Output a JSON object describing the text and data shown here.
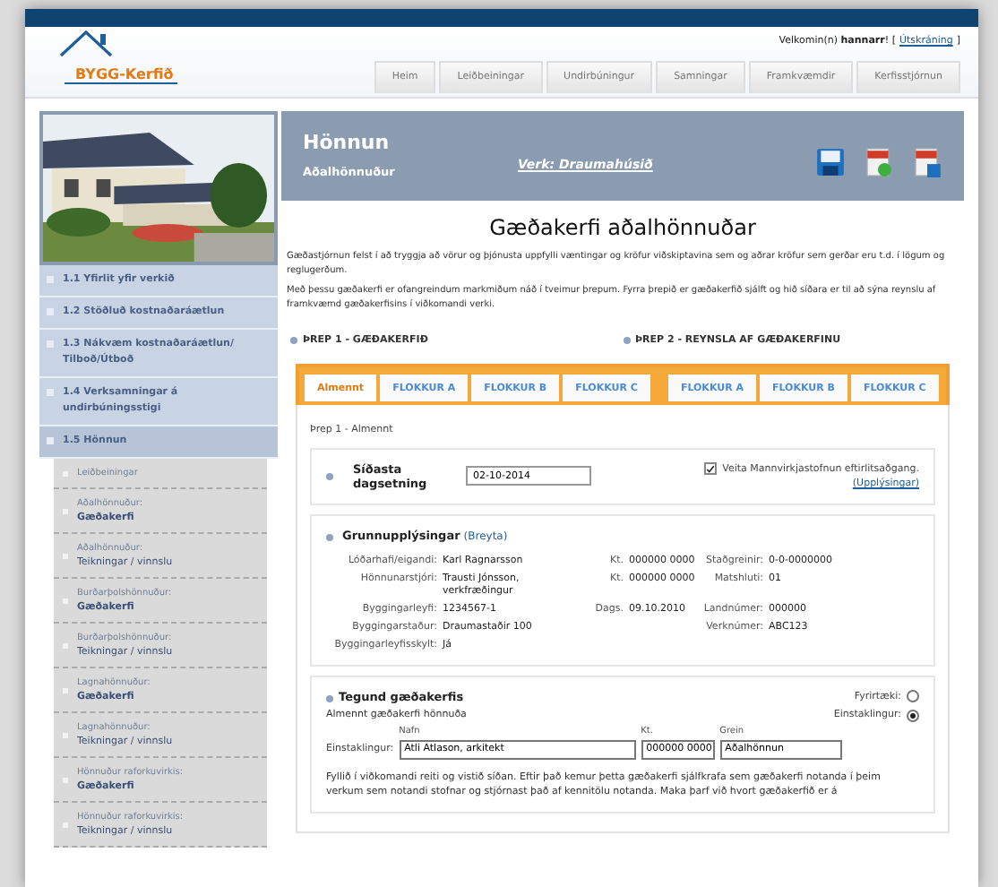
{
  "header": {
    "logo": "BYGG-Kerfið",
    "welcome": "Velkomin(n) **hannarr**! [",
    "logout": "Útskráning",
    "welcome_end": "]"
  },
  "nav": [
    {
      "label": "Heim",
      "selected": false
    },
    {
      "label": "Leiðbeiningar",
      "selected": false
    },
    {
      "label": "Undirbúningur",
      "selected": false
    },
    {
      "label": "Samningar",
      "selected": false
    },
    {
      "label": "Framkvæmdir",
      "selected": false
    },
    {
      "label": "Kerfisstjórnun",
      "selected": false
    }
  ],
  "sidebar": {
    "items": [
      {
        "label": "1.1 Yfirlit yfir verkið",
        "expanded": false
      },
      {
        "label": "1.2 Stöðluð kostnaðaráætlun",
        "expanded": false
      },
      {
        "label": "1.3 Nákvæm kostnaðaráætlun/ Tilboð/Útboð",
        "expanded": false
      },
      {
        "label": "1.4 Verksamningar á undirbúningsstigi",
        "expanded": false
      },
      {
        "label": "1.5 Hönnun",
        "expanded": true,
        "children": [
          {
            "label": "Leiðbeiningar"
          },
          {
            "label": "Aðalhönnuður:",
            "sublabel": "Gæðakerfi",
            "bold": true
          },
          {
            "label": "Aðalhönnuður:",
            "sublabel": "Teikningar / vinnslu",
            "bold": false
          },
          {
            "label": "Burðarþolshönnuður:",
            "sublabel": "Gæðakerfi",
            "bold": true
          },
          {
            "label": "Burðarþolshönnuður:",
            "sublabel": "Teikningar / vinnslu",
            "bold": false
          },
          {
            "label": "Lagnahönnuður:",
            "sublabel": "Gæðakerfi",
            "bold": true
          },
          {
            "label": "Lagnahönnuður:",
            "sublabel": "Teikningar / vinnslu",
            "bold": false
          },
          {
            "label": "Hönnuður raforkuvirkis:",
            "sublabel": "Gæðakerfi",
            "bold": true
          },
          {
            "label": "Hönnuður raforkuvirkis:",
            "sublabel": "Teikningar / vinnslu",
            "bold": false
          }
        ]
      }
    ]
  },
  "banner": {
    "title": "Hönnun",
    "subtitle": "Aðalhönnuður",
    "project": "Verk: Draumahúsið"
  },
  "heading": "Gæðakerfi aðalhönnuðar",
  "intro": [
    "Gæðastjórnun felst í að tryggja að vörur og þjónusta uppfylli væntingar og kröfur viðskiptavina sem og aðrar kröfur sem gerðar eru t.d. í lögum og reglugerðum.",
    "Með þessu gæðakerfi er ofangreindum markmiðum náð í tveimur þrepum. Fyrra þrepið er gæðakerfið sjálft og hið síðara er til að sýna reynslu af framkvæmd gæðakerfisins í viðkomandi verki."
  ],
  "steps": [
    "ÞREP 1 - GÆÐAKERFIÐ",
    "ÞREP 2 - REYNSLA AF GÆÐAKERFINU"
  ],
  "tab_groups": [
    [
      {
        "label": "Almennt",
        "selected": true
      },
      {
        "label": "FLOKKUR A",
        "selected": false
      },
      {
        "label": "FLOKKUR B",
        "selected": false
      },
      {
        "label": "FLOKKUR C",
        "selected": false
      }
    ],
    [
      {
        "label": "FLOKKUR A",
        "selected": false
      },
      {
        "label": "FLOKKUR B",
        "selected": false
      },
      {
        "label": "FLOKKUR C",
        "selected": false
      }
    ]
  ],
  "section_label": "Þrep 1 - Almennt",
  "date_card": {
    "label": "Síðasta dagsetning",
    "value": "02-10-2014",
    "consent": {
      "checked": true,
      "label": "Veita Mannvirkjastofnun eftirlitsaðgang."
    },
    "info_link": "(Upplýsingar)"
  },
  "basic_info": {
    "title": "Grunnupplýsingar",
    "edit_link": "(Breyta)",
    "rows": [
      {
        "left": {
          "label": "Lóðarhafi/eigandi:",
          "value": "Karl Ragnarsson"
        },
        "middle": {
          "label": "Kt.",
          "value": "000000 0000"
        },
        "right": {
          "label": "Staðgreinir:",
          "value": "0-0-0000000"
        }
      },
      {
        "left": {
          "label": "Hönnunarstjóri:",
          "value": "Trausti Jónsson, verkfræðingur"
        },
        "middle": {
          "label": "Kt.",
          "value": "000000 0000"
        },
        "right": {
          "label": "Matshluti:",
          "value": "01"
        }
      },
      {
        "left": {
          "label": "Byggingarleyfi:",
          "value": "1234567-1"
        },
        "middle": {
          "label": "Dags.",
          "value": "09.10.2010"
        },
        "right": {
          "label": "Landnúmer:",
          "value": "000000"
        }
      },
      {
        "left": {
          "label": "Byggingarstaður:",
          "value": "Draumastaðir 100"
        },
        "right": {
          "label": "Verknúmer:",
          "value": "ABC123"
        }
      },
      {
        "left": {
          "label": "Byggingarleyfisskylt:",
          "value": "Já"
        }
      }
    ]
  },
  "system_type": {
    "title": "Tegund gæðakerfis",
    "subtitle": "Almennt gæðakerfi hönnuða",
    "options": [
      {
        "label": "Fyrirtæki:",
        "selected": false
      },
      {
        "label": "Einstaklingur:",
        "selected": true
      }
    ],
    "row_label": "Einstaklingur:",
    "fields": [
      {
        "label": "Nafn",
        "value": "Atli Atlason, arkitekt"
      },
      {
        "label": "Kt.",
        "value": "000000 0000"
      },
      {
        "label": "Grein",
        "value": "Aðalhönnun"
      }
    ],
    "note": "Fyllið í viðkomandi reiti og vistið síðan. Eftir það kemur þetta gæðakerfi sjálfkrafa sem gæðakerfi notanda í þeim verkum sem notandi stofnar og stjórnast það af kennitölu notanda. Maka þarf við hvort gæðakerfið er á"
  }
}
